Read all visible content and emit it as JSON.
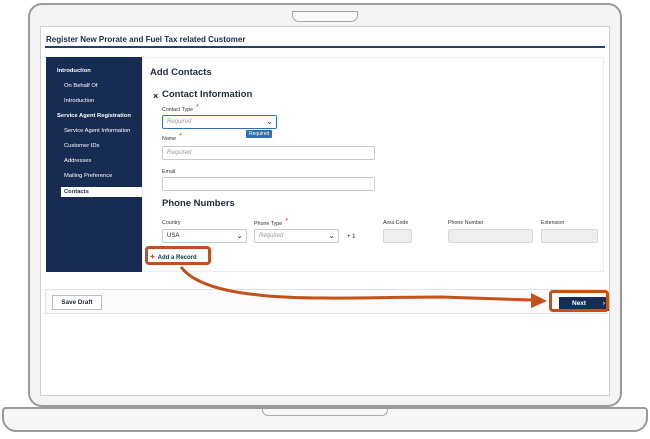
{
  "app": {
    "title": "Register New Prorate and Fuel Tax related Customer"
  },
  "sidebar": {
    "items": [
      {
        "label": "Introduction",
        "kind": "head"
      },
      {
        "label": "On Behalf Of",
        "kind": "sub"
      },
      {
        "label": "Introduction",
        "kind": "sub"
      },
      {
        "label": "Service Agent Registration",
        "kind": "head"
      },
      {
        "label": "Service Agent Information",
        "kind": "sub"
      },
      {
        "label": "Customer IDs",
        "kind": "sub"
      },
      {
        "label": "Addresses",
        "kind": "sub"
      },
      {
        "label": "Mailing Preference",
        "kind": "sub"
      },
      {
        "label": "Contacts",
        "kind": "active"
      }
    ]
  },
  "main": {
    "heading": "Add Contacts",
    "close_symbol": "×",
    "contact_section": "Contact Information",
    "contact_type": {
      "label": "Contact Type",
      "placeholder": "Required",
      "tooltip": "Required"
    },
    "name": {
      "label": "Name",
      "placeholder": "Required"
    },
    "email": {
      "label": "Email",
      "value": ""
    },
    "phone_section": "Phone Numbers",
    "country": {
      "label": "Country",
      "value": "USA"
    },
    "phone_type": {
      "label": "Phone Type",
      "placeholder": "Required"
    },
    "country_code": "+ 1",
    "area_code": {
      "label": "Area Code"
    },
    "phone_number": {
      "label": "Phone Number"
    },
    "extension": {
      "label": "Extension"
    },
    "add_record_label": "Add a Record",
    "required_mark": "*"
  },
  "footer": {
    "save_draft_label": "Save Draft",
    "next_label": "Next",
    "next_arrow": "›"
  },
  "colors": {
    "navy": "#162c52",
    "highlight": "#c4511a",
    "focus": "#2f6fb3"
  }
}
